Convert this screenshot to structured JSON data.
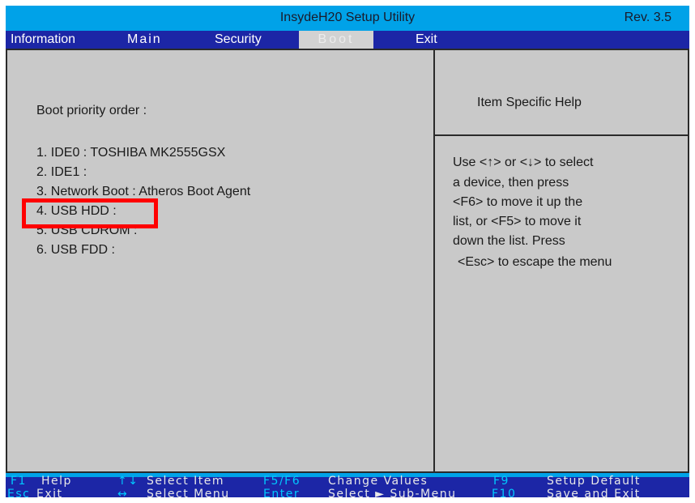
{
  "title": "InsydeH20 Setup Utility",
  "revision": "Rev.  3.5",
  "menu": {
    "information": "Information",
    "main": "Main",
    "security": "Security",
    "boot": "Boot",
    "exit": "Exit",
    "selected": "Boot"
  },
  "boot": {
    "heading": "Boot priority order :",
    "items": [
      "1. IDE0  :  TOSHIBA MK2555GSX",
      "2. IDE1  :",
      "3. Network Boot  :  Atheros Boot Agent",
      "4. USB HDD  :",
      "5. USB CDROM  :",
      "6. USB FDD  :"
    ],
    "highlighted_item": "4. USB HDD  :"
  },
  "help": {
    "title": "Item Specific Help",
    "lines": [
      "Use <↑> or <↓> to select",
      "a device, then press",
      "<F6> to move it up the",
      "list, or <F5> to move it",
      "down the list. Press",
      "<Esc> to escape the menu"
    ]
  },
  "footer": {
    "f1_key": "F1",
    "f1_desc": "Help",
    "esc_key": "Esc",
    "esc_desc": "Exit",
    "updown_key": "↑↓",
    "updown_desc": "Select  Item",
    "leftright_key": "↔",
    "leftright_desc": "Select  Menu",
    "f5f6_key": "F5/F6",
    "f5f6_desc": "Change Values",
    "enter_key": "Enter",
    "enter_desc": "Select ► Sub-Menu",
    "f9_key": "F9",
    "f9_desc": "Setup Default",
    "f10_key": "F10",
    "f10_desc": "Save and Exit"
  },
  "colors": {
    "title_bar": "#00a2e8",
    "menu_bar": "#1c26a6",
    "panel_bg": "#c9c9c9",
    "key_color": "#00c8ff",
    "highlight_box": "#ff0000"
  }
}
